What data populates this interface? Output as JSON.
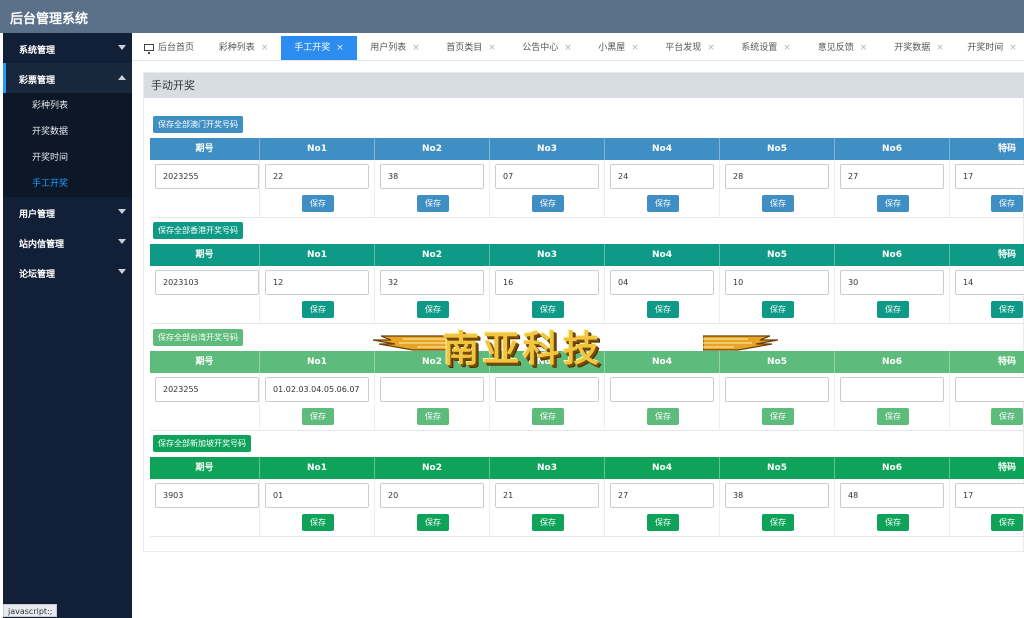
{
  "app": {
    "title": "后台管理系统"
  },
  "sidebar": {
    "groups": [
      {
        "label": "系统管理"
      },
      {
        "label": "彩票管理",
        "items": [
          "彩种列表",
          "开奖数据",
          "开奖时间",
          "手工开奖"
        ]
      },
      {
        "label": "用户管理"
      },
      {
        "label": "站内信管理"
      },
      {
        "label": "论坛管理"
      }
    ],
    "status_tip": "javascript:;"
  },
  "tabs": [
    {
      "label": "后台首页",
      "closable": false
    },
    {
      "label": "彩种列表",
      "closable": true
    },
    {
      "label": "手工开奖",
      "closable": true,
      "active": true
    },
    {
      "label": "用户列表",
      "closable": true
    },
    {
      "label": "首页类目",
      "closable": true
    },
    {
      "label": "公告中心",
      "closable": true
    },
    {
      "label": "小黑屋",
      "closable": true
    },
    {
      "label": "平台发现",
      "closable": true
    },
    {
      "label": "系统设置",
      "closable": true
    },
    {
      "label": "意见反馈",
      "closable": true
    },
    {
      "label": "开奖数据",
      "closable": true
    },
    {
      "label": "开奖时间",
      "closable": true
    }
  ],
  "tab_close": "×",
  "page": {
    "title": "手动开奖"
  },
  "columns": [
    "期号",
    "No1",
    "No2",
    "No3",
    "No4",
    "No5",
    "No6",
    "特码"
  ],
  "save_label": "保存",
  "sections": [
    {
      "button": "保存全部澳门开奖号码",
      "color": "#3f8fc4",
      "values": [
        "2023255",
        "22",
        "38",
        "07",
        "24",
        "28",
        "27",
        "17"
      ]
    },
    {
      "button": "保存全部香港开奖号码",
      "color": "#0e9a87",
      "values": [
        "2023103",
        "12",
        "32",
        "16",
        "04",
        "10",
        "30",
        "14"
      ]
    },
    {
      "button": "保存全部台湾开奖号码",
      "color": "#5dbb7b",
      "values": [
        "2023255",
        "01.02.03.04.05.06.07",
        "",
        "",
        "",
        "",
        "",
        ""
      ]
    },
    {
      "button": "保存全部新加坡开奖号码",
      "color": "#0fa35a",
      "values": [
        "3903",
        "01",
        "20",
        "21",
        "27",
        "38",
        "48",
        "17"
      ]
    }
  ],
  "watermark": {
    "text": "南亚科技"
  }
}
